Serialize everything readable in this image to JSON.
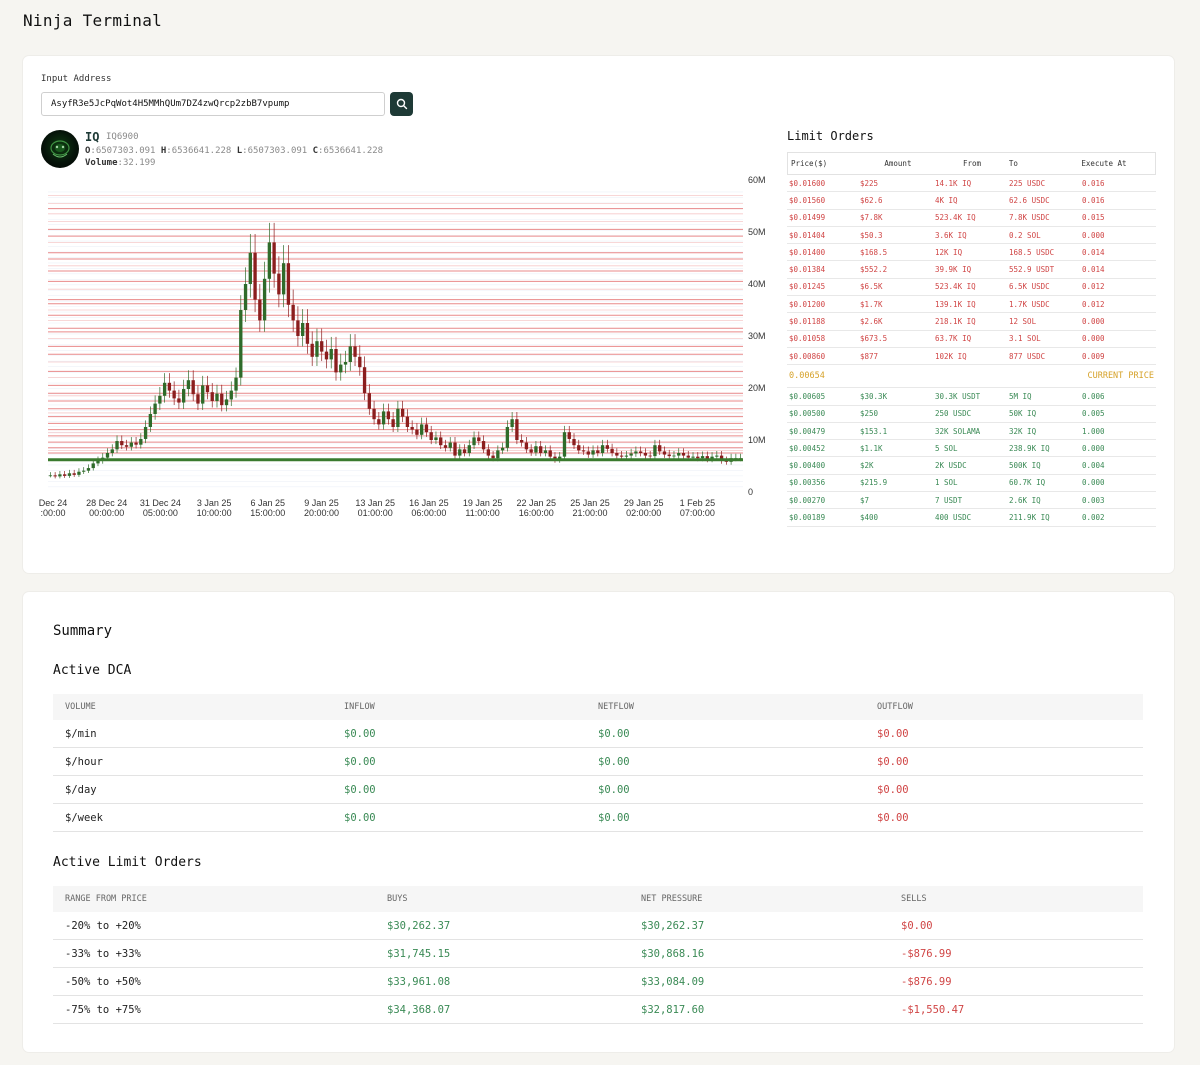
{
  "app": {
    "title": "Ninja Terminal"
  },
  "search": {
    "label": "Input Address",
    "value": "AsyfR3e5JcPqWot4H5MMhQUm7DZ4zwQrcp2zbB7vpump",
    "icon": "search-icon"
  },
  "token": {
    "symbol": "IQ",
    "ticker": "IQ6900",
    "ohlc": {
      "o": "6507303.091",
      "h": "6536641.228",
      "l": "6507303.091",
      "c": "6536641.228"
    },
    "volume": "32.199"
  },
  "chart_data": {
    "type": "candlestick",
    "y_ticks": [
      "60M",
      "50M",
      "40M",
      "30M",
      "20M",
      "10M",
      "0"
    ],
    "ylim": [
      0,
      60000000
    ],
    "x_ticks": [
      {
        "date": "Dec 24",
        "time": ":00:00"
      },
      {
        "date": "28 Dec 24",
        "time": "00:00:00"
      },
      {
        "date": "31 Dec 24",
        "time": "05:00:00"
      },
      {
        "date": "3 Jan 25",
        "time": "10:00:00"
      },
      {
        "date": "6 Jan 25",
        "time": "15:00:00"
      },
      {
        "date": "9 Jan 25",
        "time": "20:00:00"
      },
      {
        "date": "13 Jan 25",
        "time": "01:00:00"
      },
      {
        "date": "16 Jan 25",
        "time": "06:00:00"
      },
      {
        "date": "19 Jan 25",
        "time": "11:00:00"
      },
      {
        "date": "22 Jan 25",
        "time": "16:00:00"
      },
      {
        "date": "25 Jan 25",
        "time": "21:00:00"
      },
      {
        "date": "29 Jan 25",
        "time": "02:00:00"
      },
      {
        "date": "1 Feb 25",
        "time": "07:00:00"
      }
    ],
    "series": [
      {
        "values": [
          3.2,
          3.0,
          3.4,
          3.1,
          3.6,
          3.3,
          3.9,
          4.1,
          4.6,
          5.5,
          6.0,
          6.6,
          7.5,
          8.2,
          9.8,
          9.0,
          8.7,
          9.5,
          9.1,
          10.2,
          12.5,
          15.0,
          17.0,
          18.5,
          21.0,
          19.5,
          18.0,
          17.2,
          19.8,
          21.5,
          18.8,
          17.0,
          20.5,
          19.2,
          17.5,
          18.9,
          16.7,
          17.8,
          19.5,
          22.0,
          35.0,
          40.0,
          46.0,
          37.0,
          33.0,
          41.0,
          48.0,
          42.0,
          38.0,
          44.0,
          36.0,
          33.0,
          30.0,
          32.5,
          28.5,
          26.0,
          29.0,
          27.0,
          25.5,
          27.5,
          23.0,
          24.5,
          25.0,
          28.0,
          26.0,
          24.0,
          19.0,
          16.0,
          14.0,
          13.0,
          15.5,
          14.0,
          12.5,
          16.0,
          14.5,
          12.5,
          12.0,
          11.0,
          13.0,
          11.5,
          10.0,
          10.5,
          9.0,
          8.5,
          9.5,
          7.0,
          8.2,
          7.5,
          9.0,
          10.5,
          9.8,
          8.2,
          7.0,
          6.5,
          8.0,
          8.5,
          12.5,
          14.0,
          10.0,
          9.5,
          8.2,
          7.6,
          8.8,
          7.5,
          8.0,
          6.8,
          6.2,
          6.8,
          11.5,
          10.2,
          9.0,
          8.0,
          7.8,
          7.2,
          8.0,
          7.5,
          9.0,
          8.3,
          7.5,
          7.0,
          6.8,
          7.0,
          7.4,
          7.8,
          7.5,
          7.0,
          6.9,
          9.0,
          7.8,
          7.2,
          6.9,
          7.0,
          7.5,
          7.0,
          6.6,
          6.8,
          6.5,
          6.9,
          6.3,
          6.8,
          7.0,
          6.0,
          5.8,
          6.5,
          6.5,
          6.5
        ]
      }
    ],
    "order_levels_sell": [
      54.5,
      50.5,
      49.2,
      46.0,
      44.8,
      42.5,
      40.5,
      37.0,
      36.2,
      34.0,
      31.5,
      30.8,
      28.0,
      26.5,
      23.2,
      20.5,
      19.0,
      17.5,
      16.0,
      14.5,
      13.2,
      12.0,
      10.8,
      9.6,
      8.5,
      7.5
    ],
    "current_price_level": 6.2,
    "order_levels_buy": [
      57.0,
      55.5,
      53.5,
      52.0,
      48.0,
      43.5,
      39.0,
      35.0,
      33.0,
      29.5,
      25.0,
      22.0,
      18.5,
      15.2,
      11.4,
      8.0
    ]
  },
  "limit_orders": {
    "title": "Limit Orders",
    "headers": [
      "Price($)",
      "Amount",
      "From",
      "To",
      "Execute At"
    ],
    "sells": [
      [
        "$0.01600",
        "$225",
        "14.1K IQ",
        "225 USDC",
        "0.016"
      ],
      [
        "$0.01560",
        "$62.6",
        "4K IQ",
        "62.6 USDC",
        "0.016"
      ],
      [
        "$0.01499",
        "$7.8K",
        "523.4K IQ",
        "7.8K USDC",
        "0.015"
      ],
      [
        "$0.01404",
        "$50.3",
        "3.6K IQ",
        "0.2 SOL",
        "0.000"
      ],
      [
        "$0.01400",
        "$168.5",
        "12K IQ",
        "168.5 USDC",
        "0.014"
      ],
      [
        "$0.01384",
        "$552.2",
        "39.9K IQ",
        "552.9 USDT",
        "0.014"
      ],
      [
        "$0.01245",
        "$6.5K",
        "523.4K IQ",
        "6.5K USDC",
        "0.012"
      ],
      [
        "$0.01200",
        "$1.7K",
        "139.1K IQ",
        "1.7K USDC",
        "0.012"
      ],
      [
        "$0.01188",
        "$2.6K",
        "218.1K IQ",
        "12 SOL",
        "0.000"
      ],
      [
        "$0.01058",
        "$673.5",
        "63.7K IQ",
        "3.1 SOL",
        "0.000"
      ],
      [
        "$0.00860",
        "$877",
        "102K IQ",
        "877 USDC",
        "0.009"
      ]
    ],
    "current_price": "0.00654",
    "current_price_label": "CURRENT PRICE",
    "buys": [
      [
        "$0.00605",
        "$30.3K",
        "30.3K USDT",
        "5M IQ",
        "0.006"
      ],
      [
        "$0.00500",
        "$250",
        "250 USDC",
        "50K IQ",
        "0.005"
      ],
      [
        "$0.00479",
        "$153.1",
        "32K SOLAMA",
        "32K IQ",
        "1.000"
      ],
      [
        "$0.00452",
        "$1.1K",
        "5 SOL",
        "238.9K IQ",
        "0.000"
      ],
      [
        "$0.00400",
        "$2K",
        "2K USDC",
        "500K IQ",
        "0.004"
      ],
      [
        "$0.00356",
        "$215.9",
        "1 SOL",
        "60.7K IQ",
        "0.000"
      ],
      [
        "$0.00270",
        "$7",
        "7 USDT",
        "2.6K IQ",
        "0.003"
      ],
      [
        "$0.00189",
        "$400",
        "400 USDC",
        "211.9K IQ",
        "0.002"
      ]
    ]
  },
  "summary": {
    "title": "Summary",
    "dca": {
      "title": "Active DCA",
      "headers": [
        "VOLUME",
        "INFLOW",
        "NETFLOW",
        "OUTFLOW"
      ],
      "rows": [
        [
          "$/min",
          "$0.00",
          "$0.00",
          "$0.00"
        ],
        [
          "$/hour",
          "$0.00",
          "$0.00",
          "$0.00"
        ],
        [
          "$/day",
          "$0.00",
          "$0.00",
          "$0.00"
        ],
        [
          "$/week",
          "$0.00",
          "$0.00",
          "$0.00"
        ]
      ]
    },
    "limit": {
      "title": "Active Limit Orders",
      "headers": [
        "RANGE FROM PRICE",
        "BUYS",
        "NET PRESSURE",
        "SELLS"
      ],
      "rows": [
        [
          "-20% to +20%",
          "$30,262.37",
          "$30,262.37",
          "$0.00"
        ],
        [
          "-33% to +33%",
          "$31,745.15",
          "$30,868.16",
          "-$876.99"
        ],
        [
          "-50% to +50%",
          "$33,961.08",
          "$33,084.09",
          "-$876.99"
        ],
        [
          "-75% to +75%",
          "$34,368.07",
          "$32,817.60",
          "-$1,550.47"
        ]
      ]
    }
  },
  "colors": {
    "accent": "#1e3a36",
    "buy": "#3a8a55",
    "sell": "#d04545",
    "current": "#d6a22a",
    "candle_up": "#2f6b2a",
    "candle_down": "#8b1e1e"
  }
}
